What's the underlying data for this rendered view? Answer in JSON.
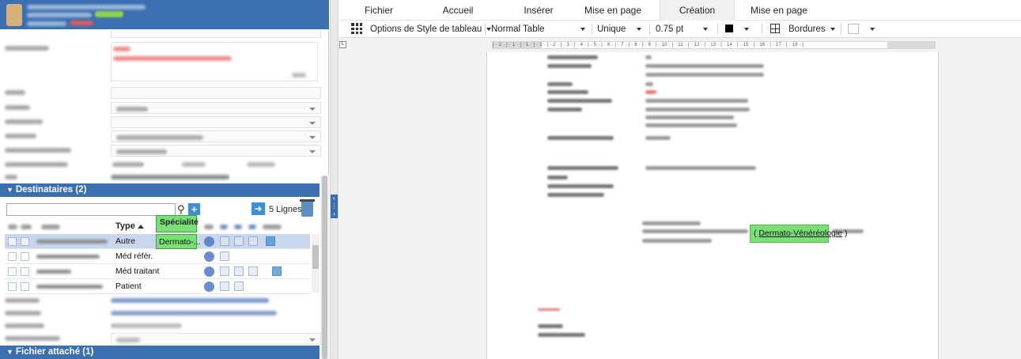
{
  "left_panel": {
    "destinataires": {
      "section_title": "Destinataires (2)",
      "lines_count": "5 Lignes",
      "columns": {
        "type": "Type",
        "specialite": "Spécialité"
      },
      "rows": [
        {
          "type": "Autre",
          "specialite": "Dermato-..."
        },
        {
          "type": "Méd référ.",
          "specialite": ""
        },
        {
          "type": "Méd traitant",
          "specialite": ""
        },
        {
          "type": "Patient",
          "specialite": ""
        }
      ]
    },
    "fichier_attache": {
      "section_title": "Fichier attaché (1)"
    }
  },
  "editor": {
    "ribbon_tabs": [
      "Fichier",
      "Accueil",
      "Insérer",
      "Mise en page",
      "Création",
      "Mise en page"
    ],
    "active_tab": "Création",
    "toolbar": {
      "table_style_options": "Options de Style de tableau",
      "table_style": "Normal Table",
      "border_style": "Unique",
      "border_width": "0.75 pt",
      "borders": "Bordures"
    },
    "ruler": "| · 2 · | · 1 · | · 1 · | · 1 · | · 2 · | · 3 · | · 4 · | · 5 · | · 6 · | · 7 · | · 8 · | · 9 · | · 10 · | · 11 · | · 12 · | · 13 · | · 14 · | · 15 · | · 16 · | · 17 · | · 18 · |",
    "document": {
      "highlight_text_open": "( ",
      "highlight_text": "Dermato-Vénéréologie",
      "highlight_text_close": " )"
    }
  },
  "colors": {
    "accent_blue": "#3a6fb2",
    "highlight_green": "#79e076",
    "selected_row": "#c8d7ee"
  }
}
